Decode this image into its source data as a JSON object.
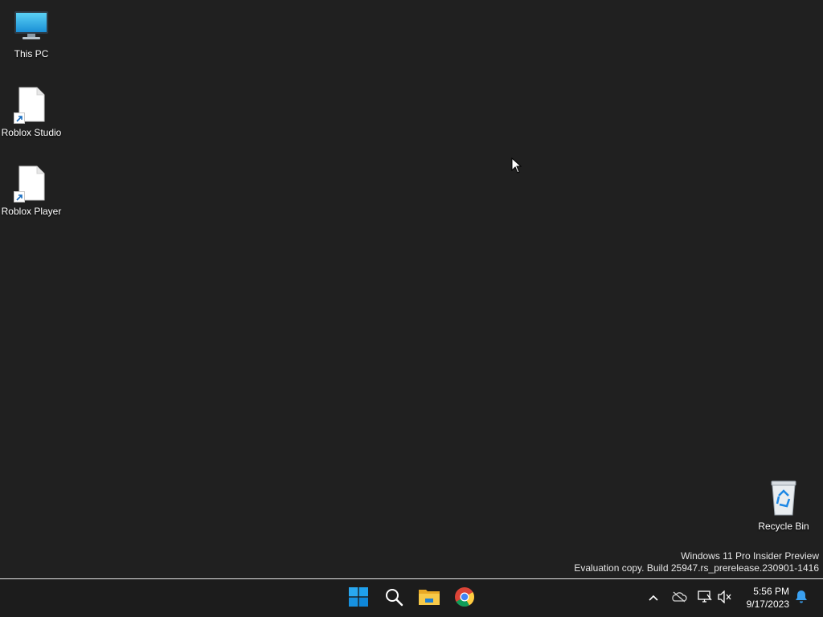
{
  "desktop": {
    "icons": [
      {
        "label": "This PC",
        "icon": "this-pc-icon"
      },
      {
        "label": "Roblox Studio",
        "icon": "blank-file-shortcut-icon"
      },
      {
        "label": "Roblox Player",
        "icon": "blank-file-shortcut-icon"
      },
      {
        "label": "Recycle Bin",
        "icon": "recycle-bin-icon"
      }
    ],
    "watermark": {
      "line1": "Windows 11 Pro Insider Preview",
      "line2": "Evaluation copy. Build 25947.rs_prerelease.230901-1416"
    }
  },
  "taskbar": {
    "apps": [
      {
        "name": "Start",
        "icon": "windows-start-icon"
      },
      {
        "name": "Search",
        "icon": "search-icon"
      },
      {
        "name": "File Explorer",
        "icon": "file-explorer-icon"
      },
      {
        "name": "Google Chrome",
        "icon": "chrome-icon"
      }
    ],
    "tray": [
      {
        "icon": "chevron-up-icon"
      },
      {
        "icon": "onedrive-offline-icon"
      },
      {
        "icon": "network-disconnected-icon"
      },
      {
        "icon": "volume-muted-icon"
      }
    ],
    "clock": {
      "time": "5:56 PM",
      "date": "9/17/2023"
    },
    "notification_icon": "notification-bell-icon"
  },
  "colors": {
    "desktop_bg": "#202020",
    "taskbar_bg": "#1c1c1c",
    "accent_blue": "#0a9ad9"
  }
}
